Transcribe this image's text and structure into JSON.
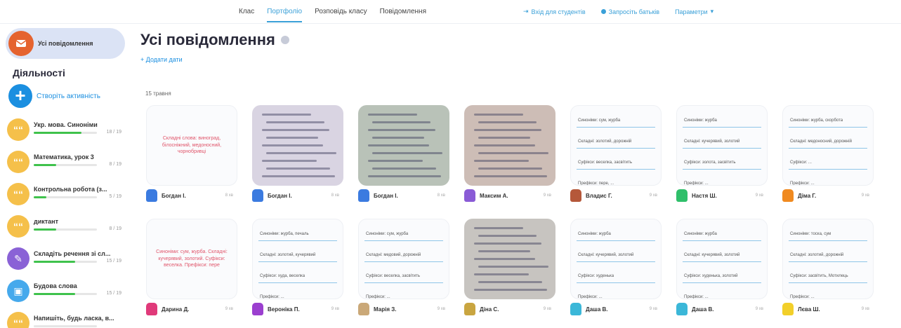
{
  "nav": {
    "tabs": [
      "Клас",
      "Портфоліо",
      "Розповідь класу",
      "Повідомлення"
    ],
    "active_tab": "Портфоліо",
    "actions": [
      "Вхід для студентів",
      "Запросіть батьків",
      "Параметри"
    ]
  },
  "sidebar": {
    "all_messages_label": "Усі повідомлення",
    "section_title": "Діяльності",
    "create_label": "Створіть активність",
    "activities": [
      {
        "name": "Укр. мова. Синоніми",
        "count": "18 / 19",
        "progress": 0.75,
        "color": "#f5c04a",
        "icon": "quote-icon"
      },
      {
        "name": "Математика, урок 3",
        "count": "8 / 19",
        "progress": 0.35,
        "color": "#f5c04a",
        "icon": "quote-icon"
      },
      {
        "name": "Контрольна робота (з...",
        "count": "5 / 19",
        "progress": 0.2,
        "color": "#f5c04a",
        "icon": "quote-icon"
      },
      {
        "name": "диктант",
        "count": "8 / 19",
        "progress": 0.35,
        "color": "#f5c04a",
        "icon": "quote-icon"
      },
      {
        "name": "Складіть речення зі сл...",
        "count": "15 / 19",
        "progress": 0.65,
        "color": "#8a62d6",
        "icon": "brush-icon"
      },
      {
        "name": "Будова слова",
        "count": "15 / 19",
        "progress": 0.65,
        "color": "#45a9ec",
        "icon": "camera-icon"
      },
      {
        "name": "Напишіть, будь ласка, в...",
        "count": "",
        "progress": 0.0,
        "color": "#f5c04a",
        "icon": "quote-icon"
      }
    ]
  },
  "main": {
    "title": "Усі повідомлення",
    "add_date": "+ Додати дати",
    "date_label": "15 травня",
    "cards": [
      {
        "student": "Богдан І.",
        "time": "8 хв",
        "type": "note",
        "note": "Складні слова: виноград, білосніжний, медоносний, чорнобривці",
        "avatar_color": "#3b7be0"
      },
      {
        "student": "Богдан І.",
        "time": "8 хв",
        "type": "photo",
        "photo_bg": "#d9d4e2",
        "avatar_color": "#3b7be0"
      },
      {
        "student": "Богдан І.",
        "time": "8 хв",
        "type": "photo",
        "photo_bg": "#b9c2b8",
        "avatar_color": "#3b7be0"
      },
      {
        "student": "Максим А.",
        "time": "9 хв",
        "type": "photo",
        "photo_bg": "#cdbdb6",
        "avatar_color": "#8a5bd6"
      },
      {
        "student": "Владис Г.",
        "time": "9 хв",
        "type": "lines",
        "lines": [
          "Синоніми: сум, журба",
          "Складні: золотий, дорожній",
          "Суфікси: веселка, засвітить",
          "Префікси: пере, ..."
        ],
        "avatar_color": "#b5583a"
      },
      {
        "student": "Настя Ш.",
        "time": "9 хв",
        "type": "lines",
        "lines": [
          "Синоніми: журба",
          "Складні: кучерявий, золотий",
          "Суфікси: золота, засвітить",
          "Префікси: ..."
        ],
        "avatar_color": "#2fbf6a"
      },
      {
        "student": "Діма Г.",
        "time": "9 хв",
        "type": "lines",
        "lines": [
          "Синоніми: журба, скорбота",
          "Складні: медоносний, дорожній",
          "Суфікси: ...",
          "Префікси: ..."
        ],
        "avatar_color": "#f08a20"
      },
      {
        "student": "Дарина Д.",
        "time": "9 хв",
        "type": "note",
        "note": "Синоніми: сум, журба. Складні: кучерявий, золотий. Суфікси: веселка. Префікси: пере",
        "avatar_color": "#e03a7a"
      },
      {
        "student": "Вероніка П.",
        "time": "9 хв",
        "type": "lines",
        "lines": [
          "Синоніми: журба, печаль",
          "Складні: золотий, кучерявий",
          "Суфікси: худа, веселка",
          "Префікси: ..."
        ],
        "avatar_color": "#9b3fcf"
      },
      {
        "student": "Марія З.",
        "time": "9 хв",
        "type": "lines",
        "lines": [
          "Синоніми: сум, журба",
          "Складні: медовий, дорожній",
          "Суфікси: веселка, засвітить",
          "Префікси: ..."
        ],
        "avatar_color": "#caa878"
      },
      {
        "student": "Діна С.",
        "time": "9 хв",
        "type": "photo",
        "photo_bg": "#c7c4c0",
        "avatar_color": "#c9a540"
      },
      {
        "student": "Даша В.",
        "time": "9 хв",
        "type": "lines",
        "lines": [
          "Синоніми: журба",
          "Складні: кучерявий, золотий",
          "Суфікси: худенька",
          "Префікси: ..."
        ],
        "avatar_color": "#3bb7d8"
      },
      {
        "student": "Даша В.",
        "time": "9 хв",
        "type": "lines",
        "lines": [
          "Синоніми: журба",
          "Складні: кучерявий, золотий",
          "Суфікси: худенька, золотий",
          "Префікси: ..."
        ],
        "avatar_color": "#3bb7d8"
      },
      {
        "student": "Лєва Ш.",
        "time": "9 хв",
        "type": "lines",
        "lines": [
          "Синоніми: тоска, сум",
          "Складні: золотий, дорожній",
          "Суфікси: засвітить, Мотилець",
          "Префікси: ..."
        ],
        "avatar_color": "#f2cf2a"
      }
    ]
  }
}
